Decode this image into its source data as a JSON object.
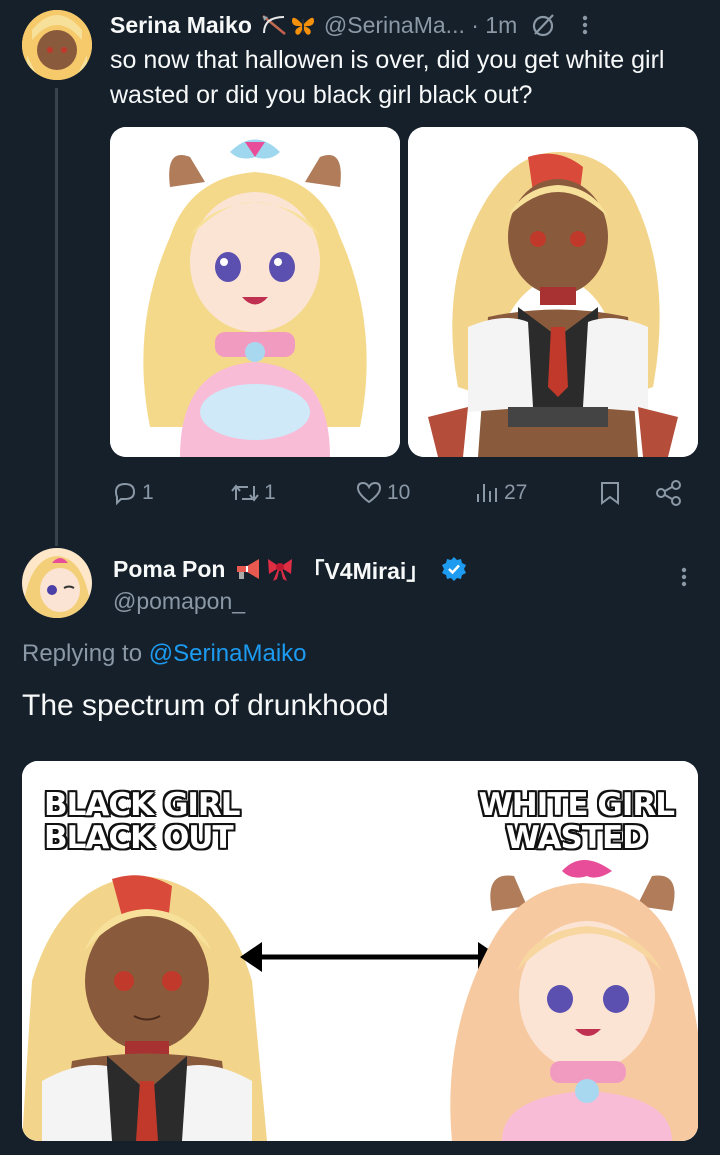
{
  "tweet1": {
    "display_name": "Serina Maiko",
    "name_emojis": "bow-and-arrow butterfly",
    "handle_time": "@SerinaMa... · 1m",
    "text": "so now that hallowen is over, did you get white girl wasted or did you black girl black out?",
    "actions": {
      "replies": "1",
      "reposts": "1",
      "likes": "10",
      "views": "27"
    }
  },
  "tweet2": {
    "display_name": "Poma Pon",
    "name_suffix": "「V4Mirai」",
    "handle": "@pomapon_",
    "replying_prefix": "Replying to ",
    "replying_to": "@SerinaMaiko",
    "text": "The spectrum of drunkhood",
    "meme": {
      "left_label_line1": "BLACK GIRL",
      "left_label_line2": "BLACK OUT",
      "right_label_line1": "WHITE GIRL",
      "right_label_line2": "WASTED"
    }
  },
  "colors": {
    "background": "#15202b",
    "text": "#f7f9f9",
    "muted": "#8b98a5",
    "link": "#1d9bf0",
    "verified": "#1d9bf0"
  }
}
